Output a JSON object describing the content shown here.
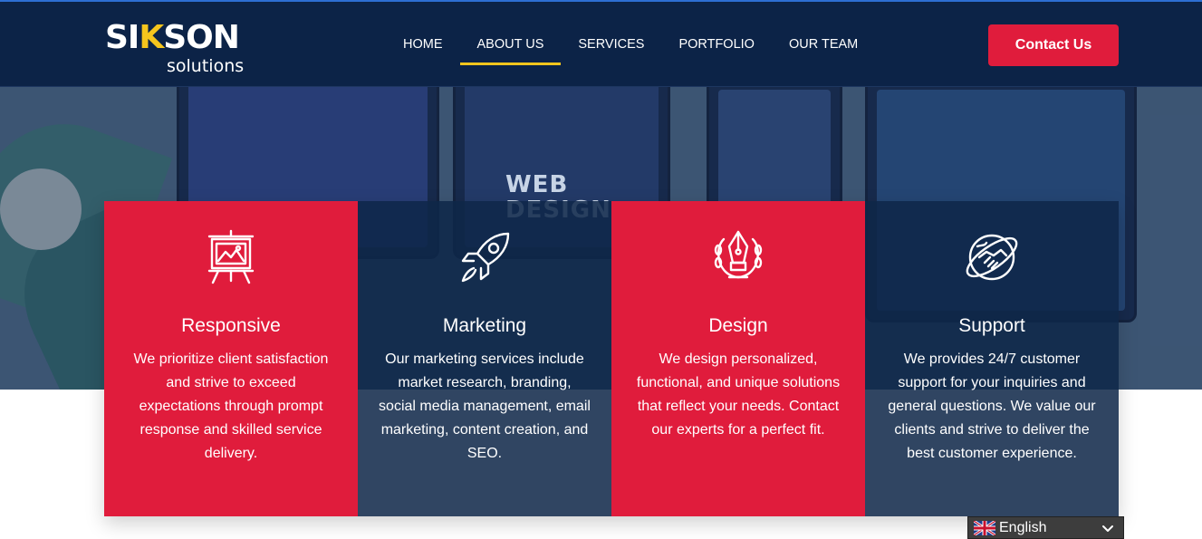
{
  "brand": {
    "logo_prefix": "SI",
    "logo_k": "K",
    "logo_suffix": "SON",
    "tagline": "solutions"
  },
  "nav": {
    "items": [
      {
        "label": "HOME",
        "active": false
      },
      {
        "label": "ABOUT US",
        "active": true
      },
      {
        "label": "SERVICES",
        "active": false
      },
      {
        "label": "PORTFOLIO",
        "active": false
      },
      {
        "label": "OUR TEAM",
        "active": false
      }
    ],
    "contact_label": "Contact Us"
  },
  "hero": {
    "image_text": "WEB DESIGN"
  },
  "features": [
    {
      "icon": "presentation-board-icon",
      "title": "Responsive",
      "text": "We prioritize client satisfaction and strive to exceed expectations through prompt response and skilled service delivery."
    },
    {
      "icon": "rocket-icon",
      "title": "Marketing",
      "text": "Our marketing services include market research, branding, social media management, email marketing, content creation, and SEO."
    },
    {
      "icon": "pen-nib-laurel-icon",
      "title": "Design",
      "text": "We design personalized, functional, and unique solutions that reflect your needs. Contact our experts for a perfect fit."
    },
    {
      "icon": "globe-handshake-icon",
      "title": "Support",
      "text": "We provides 24/7 customer support for your inquiries and general questions. We value our clients and strive to deliver the best customer experience."
    }
  ],
  "language": {
    "selected": "English",
    "flag_icon": "uk-flag-icon"
  },
  "colors": {
    "header_bg": "#0c2347",
    "accent_red": "#e01c3c",
    "accent_yellow": "#f5c51d",
    "card_navy": "#0e2648"
  }
}
